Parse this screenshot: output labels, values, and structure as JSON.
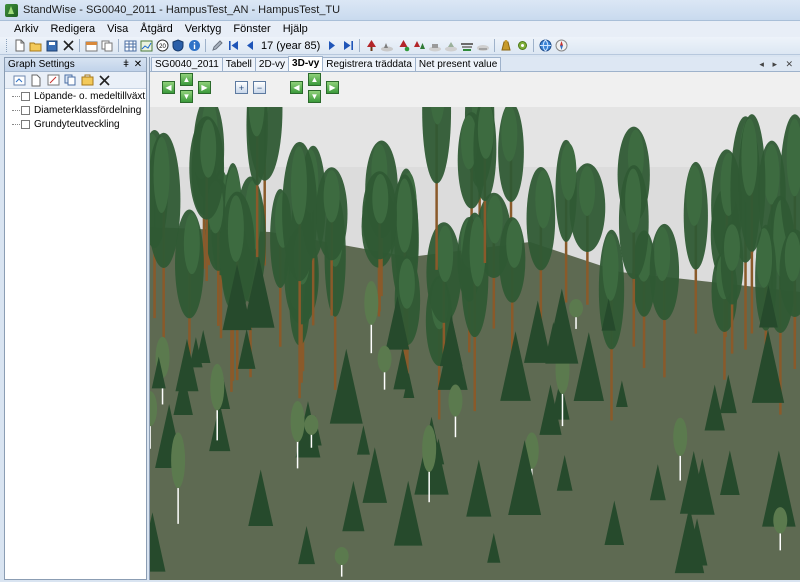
{
  "window": {
    "title": "StandWise - SG0040_2011 - HampusTest_AN - HampusTest_TU"
  },
  "menu": [
    "Arkiv",
    "Redigera",
    "Visa",
    "Åtgärd",
    "Verktyg",
    "Fönster",
    "Hjälp"
  ],
  "toolbar": {
    "year_label": "17 (year 85)",
    "icons_left": [
      "new-icon",
      "open-icon",
      "save-icon",
      "delete-icon",
      "properties-icon",
      "copy-icon",
      "table-icon",
      "chart-icon",
      "year-20-icon",
      "shield-icon",
      "info-icon",
      "pencil-icon"
    ],
    "icons_right": [
      "tree-cut-icon",
      "stand-icon",
      "tree-plant-icon",
      "thin-icon",
      "harvest-icon",
      "fertilize-icon",
      "pile-icon",
      "road-icon",
      "money-bag-icon",
      "settings-icon",
      "globe-icon",
      "compass-icon"
    ]
  },
  "left_panel": {
    "title": "Graph Settings",
    "pin": "ǂ",
    "close": "✕",
    "toolbar_icons": [
      "refresh-icon",
      "new-graph-icon",
      "edit-graph-icon",
      "copy-graph-icon",
      "export-icon",
      "delete-graph-icon"
    ],
    "items": [
      {
        "label": "Löpande- o. medeltillväxt"
      },
      {
        "label": "Diameterklassfördelning"
      },
      {
        "label": "Grundyteutveckling"
      }
    ]
  },
  "tabs": [
    {
      "label": "SG0040_2011",
      "active": false
    },
    {
      "label": "Tabell",
      "active": false
    },
    {
      "label": "2D-vy",
      "active": false
    },
    {
      "label": "3D-vy",
      "active": true
    },
    {
      "label": "Registrera träddata",
      "active": false
    },
    {
      "label": "Net present value",
      "active": false
    }
  ],
  "tab_nav": "◂ ▸ ✕",
  "view_controls": [
    "rotate-left-icon",
    "tilt-up-icon",
    "rotate-right-icon",
    "tilt-down-icon",
    "zoom-in-icon",
    "zoom-out-icon",
    "move-left-icon",
    "move-forward-icon",
    "move-right-icon",
    "move-back-icon"
  ],
  "colors": {
    "ground": "#5e6a52",
    "sky": "#dcdcdc",
    "pine": "#2f5a34",
    "bark": "#8a5a2a",
    "selection": "#ffffff"
  }
}
